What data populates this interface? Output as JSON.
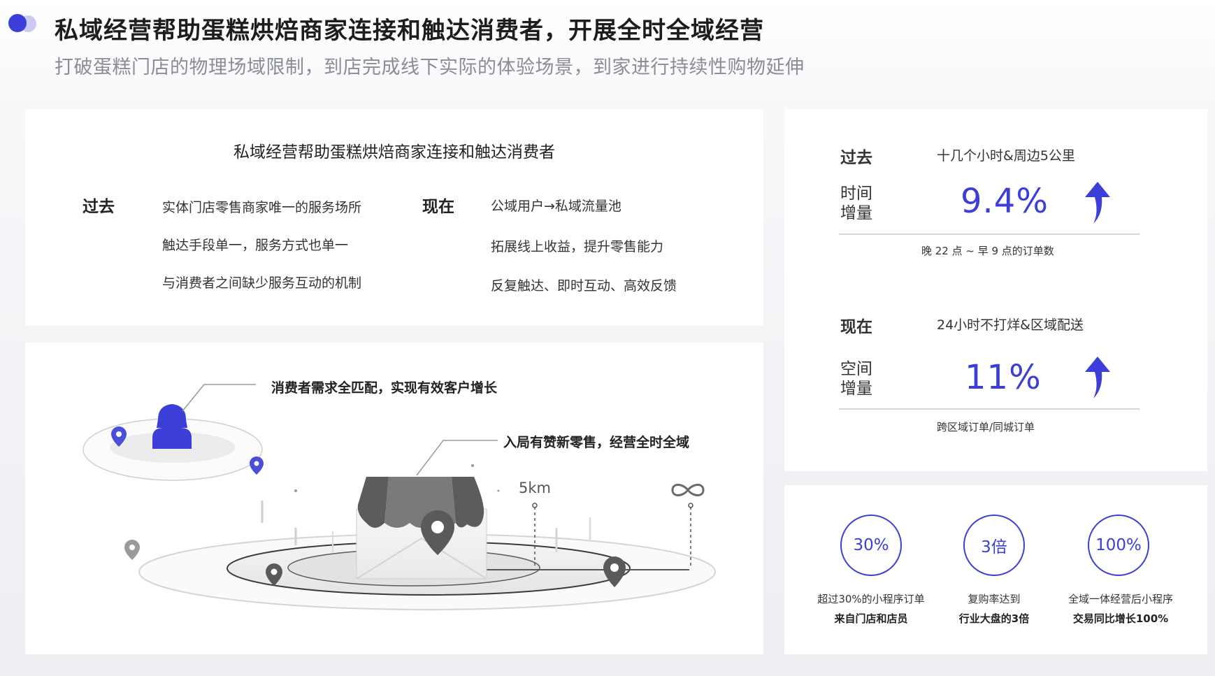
{
  "header": {
    "title": "私域经营帮助蛋糕烘焙商家连接和触达消费者，开展全时全域经营",
    "subtitle": "打破蛋糕门店的物理场域限制，到店完成线下实际的体验场景，到家进行持续性购物延伸"
  },
  "compare": {
    "title": "私域经营帮助蛋糕烘焙商家连接和触达消费者",
    "past_label": "过去",
    "past_items": [
      "实体门店零售商家唯一的服务场所",
      "触达手段单一，服务方式也单一",
      "与消费者之间缺少服务互动的机制"
    ],
    "now_label": "现在",
    "now_items": [
      "公域用户→私域流量池",
      "拓展线上收益，提升零售能力",
      "反复触达、即时互动、高效反馈"
    ]
  },
  "illustration": {
    "callout_top": "消费者需求全匹配，实现有效客户增长",
    "callout_mid": "入局有赞新零售，经营全时全域",
    "distance_label": "5km",
    "infinity_label": "∞"
  },
  "metrics": {
    "past": {
      "label": "过去",
      "desc": "十几个小时&周边5公里",
      "metric_label_1": "时间",
      "metric_label_2": "增量",
      "value": "9.4%",
      "note": "晚 22 点 ~ 早 9 点的订单数",
      "arrow_icon": "arrow-up-icon"
    },
    "now": {
      "label": "现在",
      "desc": "24小时不打烊&区域配送",
      "metric_label_1": "空间",
      "metric_label_2": "增量",
      "value": "11%",
      "note": "跨区域订单/同城订单",
      "arrow_icon": "arrow-up-icon"
    }
  },
  "stats": [
    {
      "value": "30%",
      "line1": "超过30%的小程序订单",
      "line2": "来自门店和店员"
    },
    {
      "value": "3倍",
      "line1": "复购率达到",
      "line2": "行业大盘的3倍"
    },
    {
      "value": "100%",
      "line1": "全域一体经营后小程序",
      "line2": "交易同比增长100%"
    }
  ],
  "colors": {
    "accent": "#3b3fd8",
    "accent_light": "#c9cbf4",
    "text_muted": "#8a8d94",
    "illustration_gray": "#555555"
  }
}
